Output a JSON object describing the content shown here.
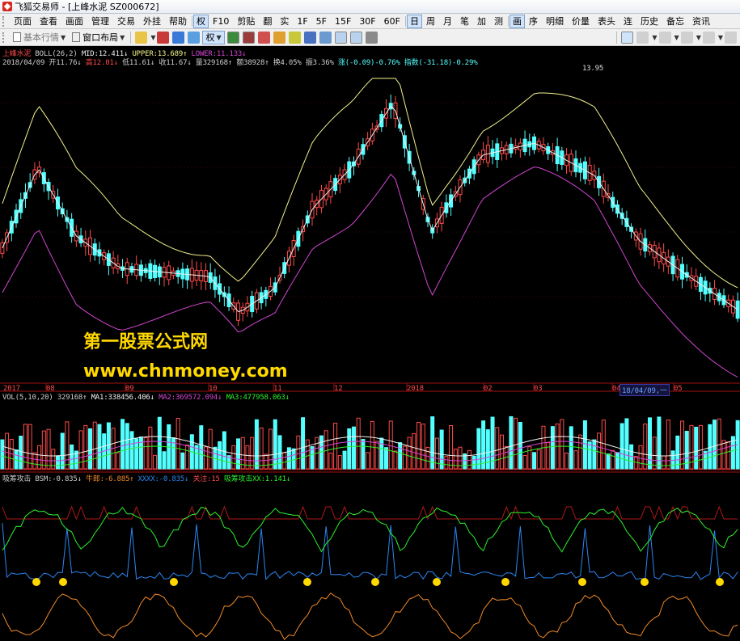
{
  "window": {
    "title": "飞狐交易师 - [上峰水泥 SZ000672]"
  },
  "menu": {
    "items": [
      "页面",
      "查看",
      "画面",
      "管理",
      "交易",
      "外挂",
      "帮助",
      "权",
      "F10",
      "剪贴",
      "翻",
      "实",
      "1F",
      "5F",
      "15F",
      "30F",
      "60F",
      "日",
      "周",
      "月",
      "笔",
      "加",
      "测",
      "画",
      "序",
      "明细",
      "价量",
      "表头",
      "连",
      "历史",
      "备忘",
      "资讯"
    ],
    "active": [
      "权",
      "日",
      "画"
    ]
  },
  "toolbar": {
    "basic_quotes": "基本行情",
    "window_layout": "窗口布局",
    "rights_label": "权"
  },
  "main_panel": {
    "stock_name": "上峰水泥",
    "indicator": "BOLL(26,2)",
    "mid": "MID:12.411↓",
    "upper": "UPPER:13.689↑",
    "lower": "LOWER:11.133↓",
    "date": "2018/04/09",
    "open": "开11.76↓",
    "high": "高12.01↓",
    "low": "低11.61↓",
    "close": "收11.67↓",
    "volume": "量329168↑",
    "amount": "额38928↑",
    "turnover": "换4.05%",
    "amplitude": "振3.36%",
    "change": "涨(-0.09)-0.76%",
    "index_change": "指数(-31.18)-0.29%",
    "peak_label": "13.95",
    "watermark_title": "第一股票公式网",
    "watermark_url": "www.chnmoney.com"
  },
  "time_axis": {
    "labels": [
      "2017",
      "08",
      "09",
      "10",
      "11",
      "12",
      "2018",
      "02",
      "03",
      "04",
      "05"
    ],
    "cursor_date": "18/04/09,一"
  },
  "volume_panel": {
    "title": "VOL(5,10,20)",
    "vol": "329168↑",
    "ma1": "MA1:338456.406↓",
    "ma2": "MA2:369572.094↓",
    "ma3": "MA3:477958.063↓"
  },
  "bottom_panel": {
    "title": "吸筹攻击",
    "bsm": "BSM:-0.835↓",
    "niulang": "牛郎:-6.885↑",
    "xxxx": "XXXX:-0.835↓",
    "guanzhu": "关注:15",
    "xcxx": "吸筹攻击XX:1.141↓"
  },
  "colors": {
    "up": "#ff4a4a",
    "down": "#54ffff",
    "boll_upper": "#f2f28c",
    "boll_mid": "#f0f0f0",
    "boll_lower": "#d246d2",
    "green_line": "#2bf22b",
    "blue_line": "#2a86f2",
    "orange_line": "#f28a2a",
    "red_line": "#b01818"
  }
}
